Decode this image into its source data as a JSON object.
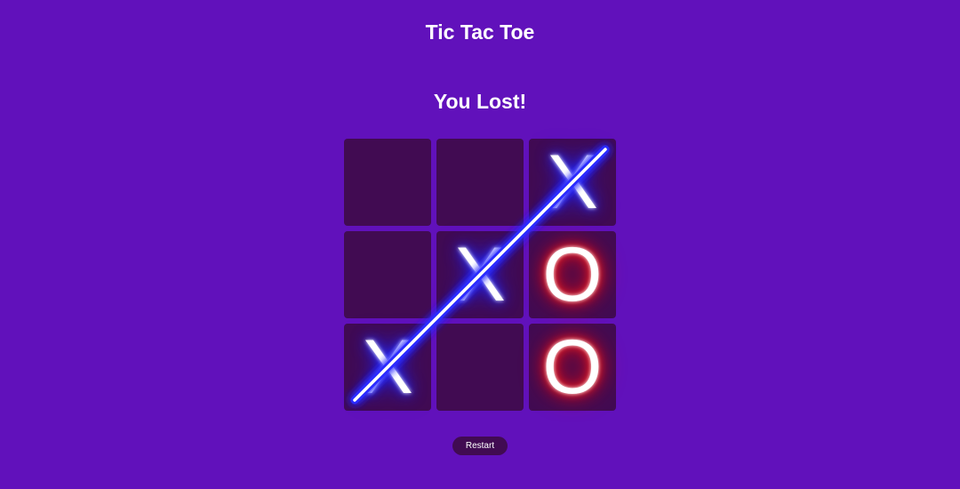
{
  "app": {
    "title": "Tic Tac Toe"
  },
  "game": {
    "status": "You Lost!",
    "board": [
      [
        "",
        "",
        "X"
      ],
      [
        "",
        "X",
        "O"
      ],
      [
        "X",
        "",
        "O"
      ]
    ],
    "winning_line": {
      "from": [
        2,
        0
      ],
      "to": [
        0,
        2
      ],
      "player": "X"
    }
  },
  "controls": {
    "restart_label": "Restart"
  },
  "colors": {
    "background": "#6111bb",
    "cell": "#410b52",
    "x_glow": "#1f24ff",
    "o_glow": "#ff1010",
    "text": "#ffffff"
  }
}
